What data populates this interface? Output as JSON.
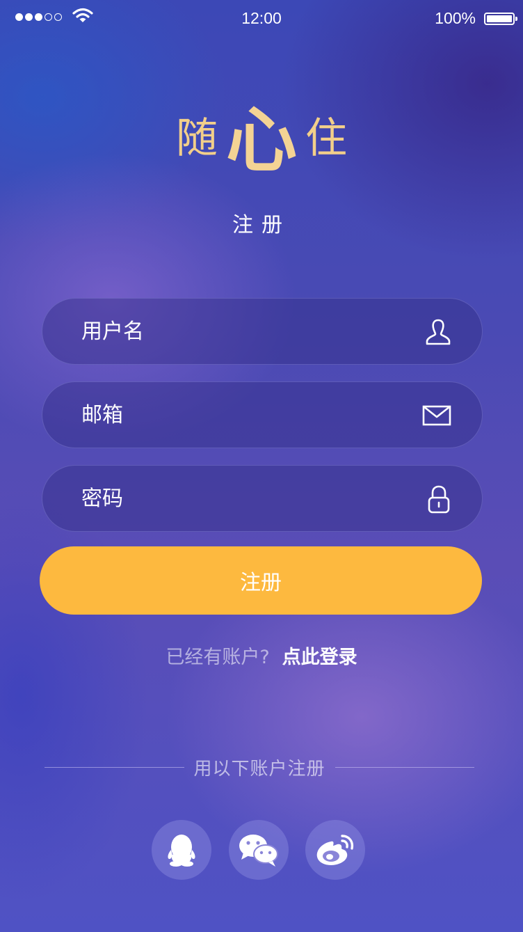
{
  "status_bar": {
    "time": "12:00",
    "battery": "100%",
    "signal_icon": "signal-dots-icon",
    "wifi_icon": "wifi-icon",
    "battery_icon": "battery-icon"
  },
  "logo": {
    "char1": "随",
    "char2": "心",
    "char3": "住"
  },
  "page_title": "注册",
  "form": {
    "username": {
      "placeholder": "用户名",
      "value": "",
      "icon": "user-icon"
    },
    "email": {
      "placeholder": "邮箱",
      "value": "",
      "icon": "mail-icon"
    },
    "password": {
      "placeholder": "密码",
      "value": "",
      "icon": "lock-icon"
    },
    "submit_label": "注册"
  },
  "login_prompt": {
    "question": "已经有账户?",
    "link": "点此登录"
  },
  "social": {
    "divider_text": "用以下账户注册",
    "providers": [
      {
        "name": "qq",
        "icon": "qq-penguin-icon"
      },
      {
        "name": "wechat",
        "icon": "wechat-icon"
      },
      {
        "name": "weibo",
        "icon": "weibo-icon"
      }
    ]
  },
  "colors": {
    "accent": "#fdb93f",
    "logo": "#f2cf8a",
    "background_top": "#3c48b6",
    "background_bottom": "#4f52c4"
  }
}
